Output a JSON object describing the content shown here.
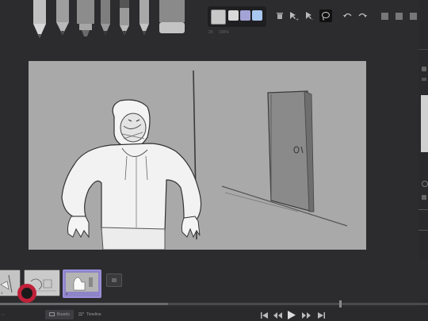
{
  "toolbar": {
    "tools": [
      {
        "name": "pencil-hard",
        "color": "#b8b8b8"
      },
      {
        "name": "pencil-soft",
        "color": "#a8a8a8"
      },
      {
        "name": "marker",
        "color": "#9a9a9a"
      },
      {
        "name": "brush-thin",
        "color": "#8e8e8e"
      },
      {
        "name": "pen",
        "color": "#a0a0a0"
      },
      {
        "name": "pencil-fine",
        "color": "#b0b0b0"
      },
      {
        "name": "eraser",
        "color": "#c0c0c0"
      }
    ],
    "swatches": {
      "main_color": "#c8c8c8",
      "colors": [
        "#d9d9d9",
        "#a3a3d6",
        "#a9c8f0"
      ],
      "labels": [
        "20",
        "100%"
      ]
    },
    "actions": [
      "trash-icon",
      "select-add-icon",
      "select-remove-icon",
      "lasso-icon",
      "undo-icon",
      "redo-icon"
    ]
  },
  "timeline": {
    "frames": [
      {
        "number": "1"
      },
      {
        "number": "2"
      },
      {
        "number": "3",
        "selected": true
      }
    ],
    "tabs": [
      {
        "label": "Boards",
        "active": true
      },
      {
        "label": "Timeline",
        "active": false
      }
    ]
  },
  "colors": {
    "accent": "#9a8fd8",
    "record": "#c0213a",
    "background": "#2c2c2e",
    "canvas": "#a9a9a9"
  }
}
